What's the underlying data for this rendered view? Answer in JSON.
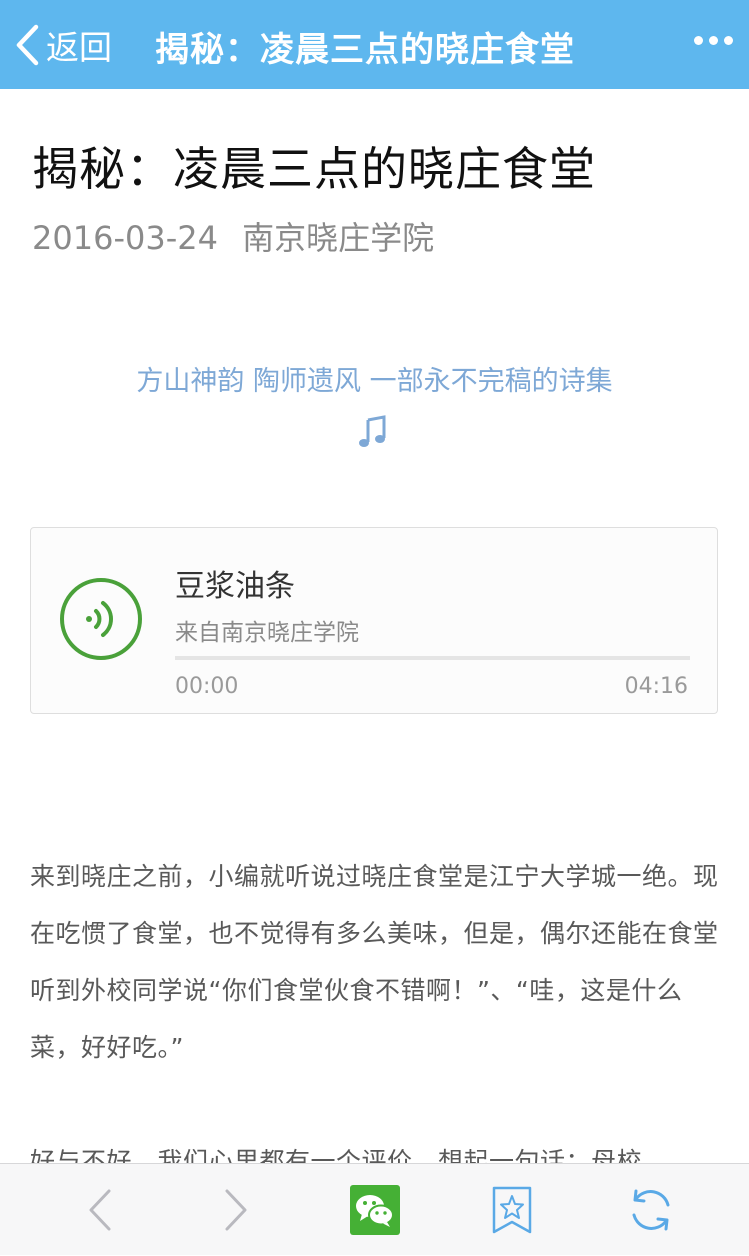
{
  "navbar": {
    "back_label": "返回",
    "title": "揭秘：凌晨三点的晓庄食堂",
    "more_icon": "more-dots-icon"
  },
  "article": {
    "title": "揭秘：凌晨三点的晓庄食堂",
    "date": "2016-03-24",
    "author": "南京晓庄学院",
    "subtitle": "方山神韵  陶师遗风  一部永不完稿的诗集",
    "music_icon": "music-note-icon"
  },
  "audio": {
    "title": "豆浆油条",
    "source": "来自南京晓庄学院",
    "current_time": "00:00",
    "duration": "04:16",
    "progress": 0,
    "accent_color": "#4aa13a"
  },
  "body": {
    "paragraphs": [
      "来到晓庄之前，小编就听说过晓庄食堂是江宁大学城一绝。现在吃惯了食堂，也不觉得有多么美味，但是，偶尔还能在食堂听到外校同学说“你们食堂伙食不错啊！”、“哇，这是什么菜，好好吃。”",
      "好与不好，我们心里都有一个评价，想起一句话：母校"
    ]
  },
  "toolbar": {
    "items": [
      "back-arrow-icon",
      "forward-arrow-icon",
      "wechat-icon",
      "bookmark-star-icon",
      "refresh-icon"
    ]
  },
  "colors": {
    "navbar": "#5eb7ee",
    "subtitle": "#7ea8d6",
    "toolbar_icon": "#5aa9e6"
  }
}
